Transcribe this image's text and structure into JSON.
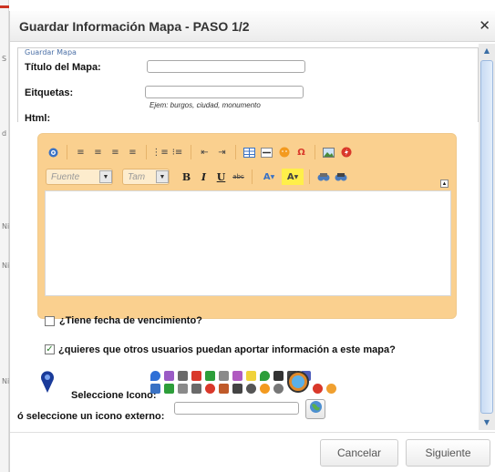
{
  "background_page": {
    "letters": [
      "S",
      "d",
      "Ni",
      "Ni",
      "Ni"
    ]
  },
  "dialog": {
    "title": "Guardar Información Mapa - PASO 1/2",
    "close_icon": "close-icon",
    "fieldset_legend": "Guardar Mapa",
    "fields": {
      "title_label": "Título del Mapa:",
      "title_value": "",
      "tags_label": "Eitquetas:",
      "tags_value": "",
      "tags_hint": "Ejem: burgos, ciudad, monumento",
      "html_label": "Html:"
    },
    "editor": {
      "font_placeholder": "Fuente",
      "size_placeholder": "Tam",
      "bold": "B",
      "italic": "I",
      "underline": "U",
      "strike": "abc",
      "text_color": "A",
      "bg_color": "A",
      "colors": {
        "panel": "#fad08f",
        "accent_red": "#d9382a",
        "accent_blue": "#3a72c4"
      }
    },
    "expiry_checkbox": {
      "label": "¿Tiene fecha de vencimiento?",
      "checked": false
    },
    "contribute_checkbox": {
      "label": "¿quieres que otros usuarios puedan aportar información a este mapa?",
      "checked": true
    },
    "icon_label": "Seleccione Icono:",
    "external_icon_label": "ó seleccione un icono externo:",
    "external_icon_value": "",
    "buttons": {
      "cancel": "Cancelar",
      "next": "Siguiente"
    }
  }
}
